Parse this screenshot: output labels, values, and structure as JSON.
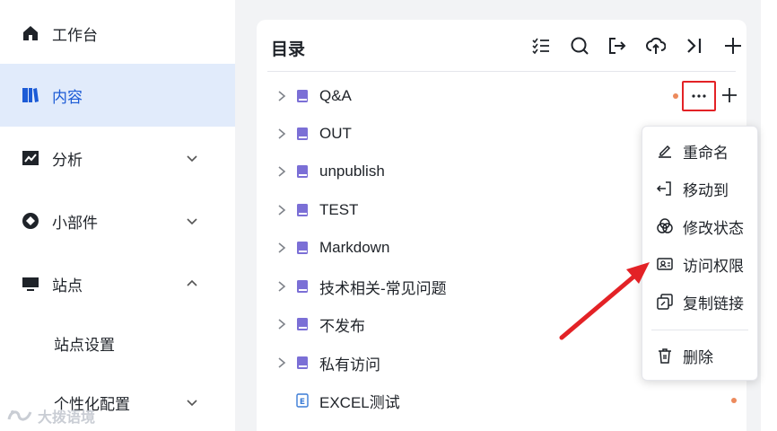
{
  "sidebar": {
    "items": [
      {
        "label": "工作台",
        "icon": "home-icon"
      },
      {
        "label": "内容",
        "icon": "content-book-icon"
      },
      {
        "label": "分析",
        "icon": "chart-icon"
      },
      {
        "label": "小部件",
        "icon": "widget-icon"
      },
      {
        "label": "站点",
        "icon": "monitor-icon"
      }
    ],
    "sub_items": [
      {
        "label": "站点设置"
      },
      {
        "label": "个性化配置"
      }
    ]
  },
  "watermark": {
    "text": "大拨语境"
  },
  "panel": {
    "title": "目录",
    "toolbar": [
      "checklist-icon",
      "search-icon",
      "export-icon",
      "upload-icon",
      "collapse-icon",
      "add-icon"
    ]
  },
  "tree": {
    "items": [
      {
        "name": "Q&A",
        "type": "folder"
      },
      {
        "name": "OUT",
        "type": "folder"
      },
      {
        "name": "unpublish",
        "type": "folder"
      },
      {
        "name": "TEST",
        "type": "folder"
      },
      {
        "name": "Markdown",
        "type": "folder"
      },
      {
        "name": "技术相关-常见问题",
        "type": "folder"
      },
      {
        "name": "不发布",
        "type": "folder"
      },
      {
        "name": "私有访问",
        "type": "folder"
      },
      {
        "name": "EXCEL测试",
        "type": "document"
      }
    ]
  },
  "menu": {
    "items": [
      {
        "label": "重命名",
        "icon": "rename-icon"
      },
      {
        "label": "移动到",
        "icon": "move-icon"
      },
      {
        "label": "修改状态",
        "icon": "status-icon"
      },
      {
        "label": "访问权限",
        "icon": "access-icon"
      },
      {
        "label": "复制链接",
        "icon": "copy-link-icon"
      },
      {
        "label": "删除",
        "icon": "delete-icon"
      }
    ]
  },
  "colors": {
    "accent": "#1c5bd6",
    "active_bg": "#e1ebfb",
    "book": "#7b6fd6",
    "status_dot": "#ec8a5c",
    "highlight": "#e32226"
  }
}
